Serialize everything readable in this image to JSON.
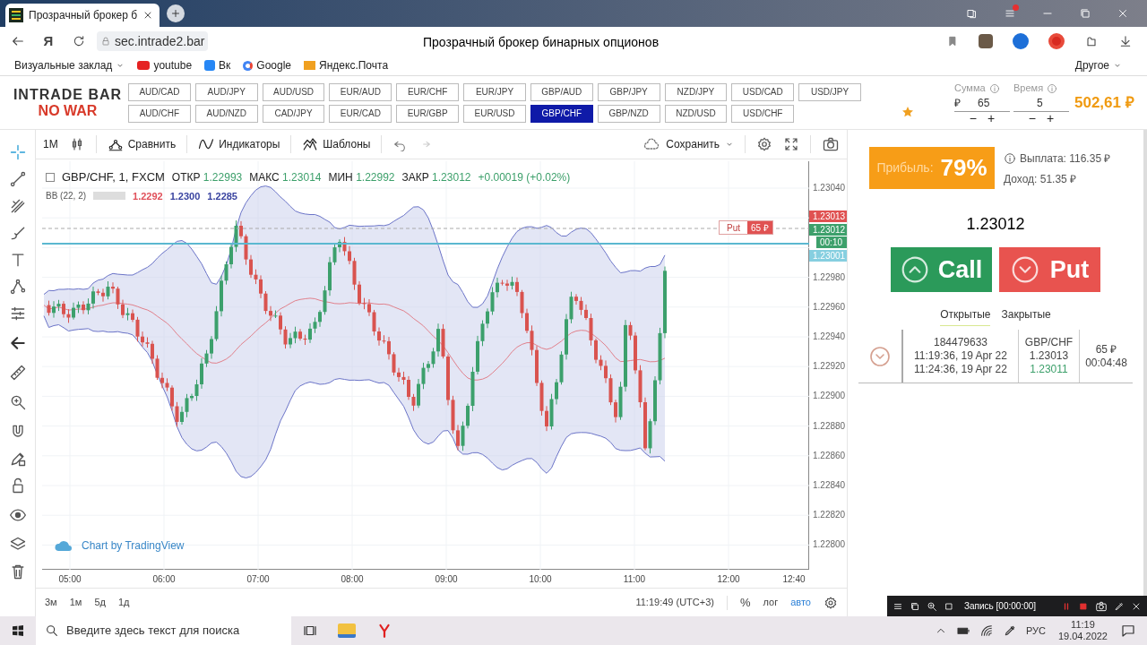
{
  "browser": {
    "tab_title": "Прозрачный брокер б",
    "address": "sec.intrade2.bar",
    "yandex_button": "Я",
    "page_title": "Прозрачный брокер бинарных опционов",
    "bookmarks": [
      {
        "kind": "folder",
        "label": "Визуальные заклад"
      },
      {
        "kind": "youtube",
        "label": "youtube"
      },
      {
        "kind": "vk",
        "label": "Вк"
      },
      {
        "kind": "google",
        "label": "Google"
      },
      {
        "kind": "mail",
        "label": "Яндекс.Почта"
      }
    ],
    "other": "Другое"
  },
  "header": {
    "logo_top": "INTRADE BAR",
    "logo_bottom": "NO WAR",
    "pairs": [
      {
        "label": "AUD/CAD",
        "selected": false
      },
      {
        "label": "AUD/JPY",
        "selected": false
      },
      {
        "label": "AUD/USD",
        "selected": false
      },
      {
        "label": "EUR/AUD",
        "selected": false
      },
      {
        "label": "EUR/CHF",
        "selected": false
      },
      {
        "label": "EUR/JPY",
        "selected": false
      },
      {
        "label": "GBP/AUD",
        "selected": false
      },
      {
        "label": "GBP/JPY",
        "selected": false
      },
      {
        "label": "NZD/JPY",
        "selected": false
      },
      {
        "label": "USD/CAD",
        "selected": false
      },
      {
        "label": "USD/JPY",
        "selected": false
      },
      {
        "label": "AUD/CHF",
        "selected": false
      },
      {
        "label": "AUD/NZD",
        "selected": false
      },
      {
        "label": "CAD/JPY",
        "selected": false
      },
      {
        "label": "EUR/CAD",
        "selected": false
      },
      {
        "label": "EUR/GBP",
        "selected": false
      },
      {
        "label": "EUR/USD",
        "selected": false
      },
      {
        "label": "GBP/CHF",
        "selected": true
      },
      {
        "label": "GBP/NZD",
        "selected": false
      },
      {
        "label": "NZD/USD",
        "selected": false
      },
      {
        "label": "USD/CHF",
        "selected": false
      }
    ],
    "amount": {
      "label": "Сумма",
      "currency": "₽",
      "value": "65",
      "minus": "−",
      "plus": "+"
    },
    "time": {
      "label": "Время",
      "value": "5",
      "minus": "−",
      "plus": "+"
    },
    "balance": "502,61 ₽"
  },
  "chart_toolbar": {
    "interval": "1M",
    "compare": "Сравнить",
    "indicators": "Индикаторы",
    "templates": "Шаблоны",
    "save": "Сохранить"
  },
  "legend": {
    "symbol": "GBP/CHF, 1, FXCM",
    "values": [
      {
        "label": "ОТКР",
        "value": "1.22993"
      },
      {
        "label": "МАКС",
        "value": "1.23014"
      },
      {
        "label": "МИН",
        "value": "1.22992"
      },
      {
        "label": "ЗАКР",
        "value": "1.23012"
      }
    ],
    "change": "+0.00019 (+0.02%)",
    "indicator": "BB (22, 2)",
    "indicator_values": [
      {
        "value": "1.2292",
        "color": "#e0505a"
      },
      {
        "value": "1.2300",
        "color": "#3a44a0"
      },
      {
        "value": "1.2285",
        "color": "#3a44a0"
      }
    ]
  },
  "price_axis": [
    "1.23040",
    "1.22980",
    "1.22960",
    "1.22940",
    "1.22920",
    "1.22900",
    "1.22880",
    "1.22860",
    "1.22840",
    "1.22820",
    "1.22800"
  ],
  "price_tags": [
    {
      "text": "1.23013",
      "color": "#e05252"
    },
    {
      "text": "1.23012",
      "color": "#3da06b"
    },
    {
      "text": "00:10",
      "color": "#3da06b"
    },
    {
      "text": "1.23001",
      "color": "#86cfe0"
    }
  ],
  "trade_marker": {
    "label": "Put",
    "amount": "65 ₽"
  },
  "time_axis": [
    "05:00",
    "06:00",
    "07:00",
    "08:00",
    "09:00",
    "10:00",
    "11:00",
    "12:00",
    "12:40"
  ],
  "attribution": "Chart by TradingView",
  "ranges": [
    "3м",
    "1м",
    "5д",
    "1д"
  ],
  "clock": "11:19:49 (UTC+3)",
  "scale_buttons": [
    {
      "label": "%",
      "on": false
    },
    {
      "label": "лог",
      "on": false
    },
    {
      "label": "авто",
      "on": true
    }
  ],
  "panel": {
    "profit_label": "Прибыль:",
    "profit": "79%",
    "payout": "Выплата: 116.35 ₽",
    "income": "Доход: 51.35 ₽",
    "price": "1.23012",
    "call": "Call",
    "put": "Put",
    "tabs": [
      {
        "label": "Открытые",
        "selected": true
      },
      {
        "label": "Закрытые",
        "selected": false
      }
    ],
    "trades": [
      {
        "id": "184479633",
        "open_time": "11:19:36, 19 Apr 22",
        "close_time": "11:24:36, 19 Apr 22",
        "pair": "GBP/CHF",
        "open_price": "1.23013",
        "close_price": "1.23011",
        "amount": "65 ₽",
        "remaining": "00:04:48"
      }
    ]
  },
  "recorder": {
    "label": "Запись [00:00:00]"
  },
  "taskbar": {
    "search_placeholder": "Введите здесь текст для поиска",
    "language": "РУС",
    "time": "11:19",
    "date": "19.04.2022"
  }
}
